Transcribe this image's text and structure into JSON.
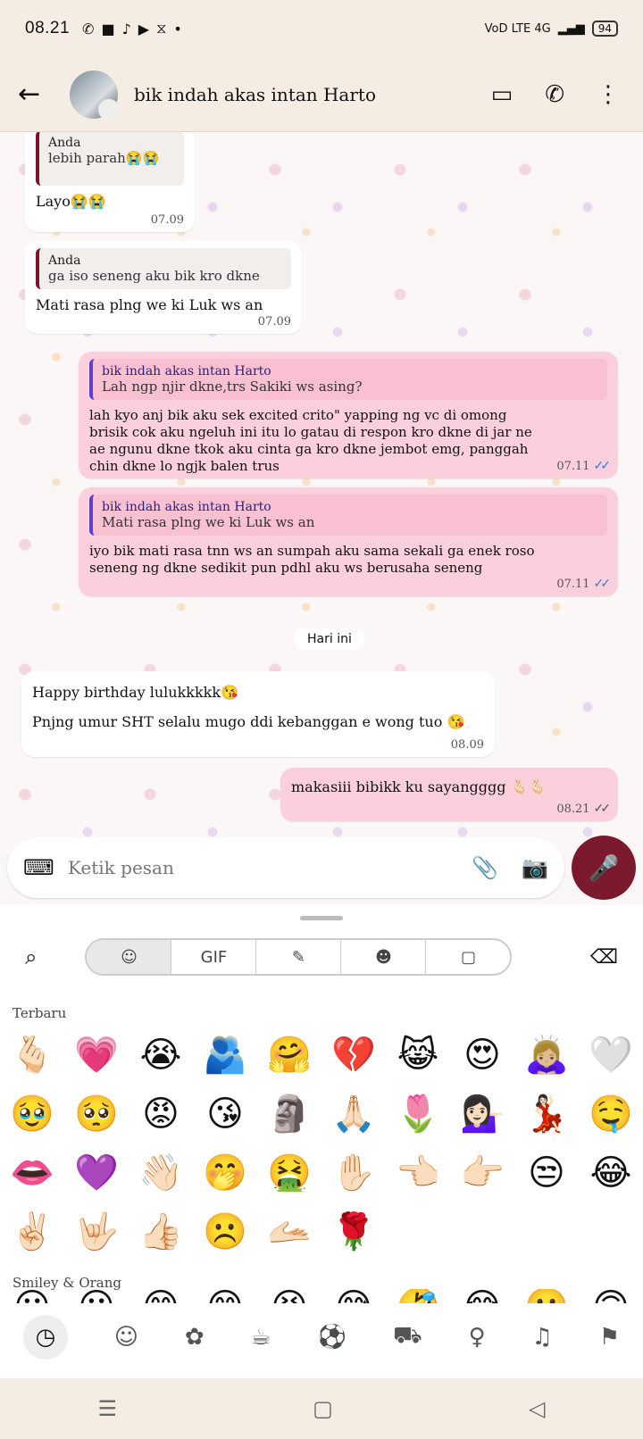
{
  "status_bar": {
    "time": "08.21",
    "notifications": [
      "whatsapp-icon",
      "shop-icon",
      "tiktok-icon",
      "play-icon",
      "capcut-icon",
      "dot-icon"
    ],
    "network": "VoD LTE 4G",
    "battery": "94"
  },
  "header": {
    "contact_name": "bik indah akas intan Harto"
  },
  "messages": [
    {
      "direction": "in",
      "quote_author": "Anda",
      "quote_text": "lebih parah😭😭",
      "text": "Layo😭😭",
      "time": "07.09"
    },
    {
      "direction": "in",
      "quote_author": "Anda",
      "quote_text": "ga iso seneng aku bik kro dkne",
      "text": "Mati rasa plng we ki Luk ws an",
      "time": "07.09"
    },
    {
      "direction": "out",
      "quote_author": "bik indah akas intan Harto",
      "quote_text": "Lah ngp njir dkne,trs Sakiki ws asing?",
      "text": "lah kyo anj bik aku sek excited crito\" yapping ng vc di omong brisik cok aku ngeluh ini itu lo gatau di respon kro dkne di jar ne ae ngunu dkne tkok aku cinta ga kro dkne jembot emg, panggah chin dkne lo ngjk balen trus",
      "time": "07.11",
      "ticks": "✓✓"
    },
    {
      "direction": "out",
      "quote_author": "bik indah akas intan Harto",
      "quote_text": "Mati rasa plng we ki Luk ws an",
      "text": "iyo bik mati rasa tnn ws an sumpah aku sama sekali ga enek roso seneng ng dkne sedikit pun pdhl aku ws berusaha seneng",
      "time": "07.11",
      "ticks": "✓✓"
    },
    {
      "direction": "in",
      "line1": "Happy birthday lulukkkkk😘",
      "line2": "Pnjng umur SHT selalu mugo ddi kebanggan e wong tuo 😘",
      "time": "08.09"
    },
    {
      "direction": "out",
      "text": "makasiii bibikk ku sayangggg 🫰🏻🫰🏻",
      "time": "08.21",
      "ticks": "✓✓"
    }
  ],
  "day_separator": "Hari ini",
  "input": {
    "placeholder": "Ketik pesan"
  },
  "keyboard": {
    "tabs": [
      "☺",
      "GIF",
      "✎",
      "☻",
      "▢"
    ],
    "section_recent": "Terbaru",
    "section_smiley": "Smiley & Orang",
    "recent_emojis": [
      "🫰🏻",
      "💗",
      "😭",
      "🫂",
      "🤗",
      "💔",
      "😹",
      "😍",
      "🙇🏼‍♀️",
      "🤍",
      "🥹",
      "🥺",
      "😡",
      "😘",
      "🗿",
      "🙏🏻",
      "🌷",
      "💁🏻‍♀️",
      "💃🏻",
      "🤤",
      "👄",
      "💜",
      "👋🏻",
      "🤭",
      "🤮",
      "✋🏻",
      "👈🏻",
      "👉🏻",
      "😒",
      "😂",
      "✌🏻",
      "🤟🏻",
      "👍🏻",
      "☹️",
      "🫴🏻",
      "🌹"
    ],
    "smiley_partial": [
      "😀",
      "😃",
      "😄",
      "😁",
      "😆",
      "😅",
      "🤣",
      "😂",
      "🙂",
      "🙃"
    ],
    "categories": [
      "recent-icon",
      "smiley-icon",
      "animal-icon",
      "food-icon",
      "sport-icon",
      "car-icon",
      "bulb-icon",
      "symbols-icon",
      "flag-icon"
    ]
  }
}
